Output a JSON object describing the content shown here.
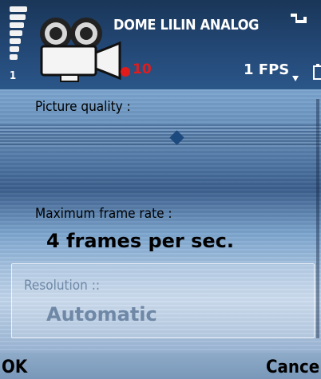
{
  "status": {
    "signal_label": "1",
    "title": "DOME LILIN ANALOG",
    "recording_count": "10",
    "fps_label": "1 FPS"
  },
  "icons": {
    "signal": "signal-strength-icon",
    "camera": "video-camera-icon",
    "connection": "connection-icon",
    "record": "record-dot-icon",
    "dropdown": "dropdown-arrow-icon",
    "battery": "battery-icon"
  },
  "settings": {
    "picture_quality_label": "Picture quality :",
    "max_frame_rate_label": "Maximum frame rate :",
    "max_frame_rate_value": "4 frames per sec.",
    "resolution_label": "Resolution ::",
    "resolution_value": "Automatic"
  },
  "softkeys": {
    "left": "OK",
    "right": "Cance"
  },
  "colors": {
    "record_red": "#e41b1b",
    "header_blue": "#234876",
    "disabled_text": "#6f88a6"
  }
}
